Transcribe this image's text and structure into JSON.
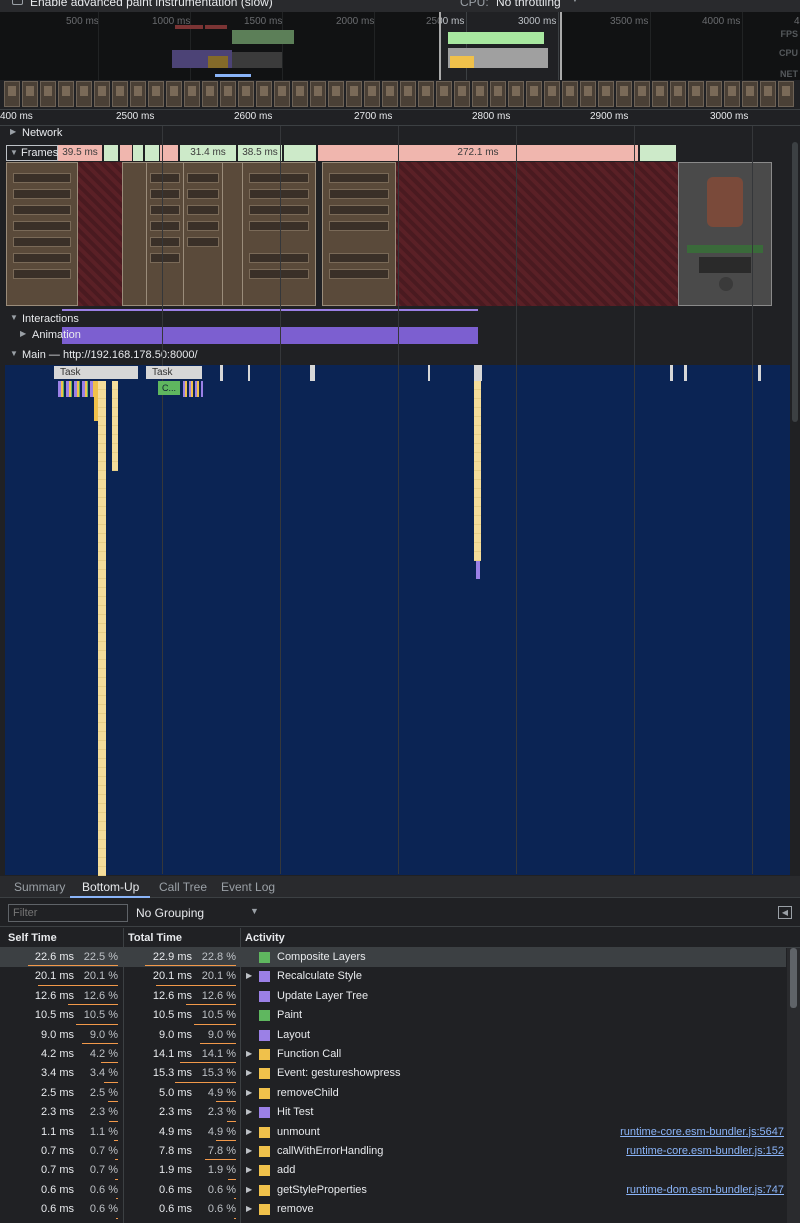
{
  "toolbar": {
    "paint_checkbox_label": "Enable advanced paint instrumentation (slow)",
    "cpu_label": "CPU:",
    "cpu_value": "No throttling"
  },
  "overview": {
    "ticks": [
      "500 ms",
      "1000 ms",
      "1500 ms",
      "2000 ms",
      "2500 ms",
      "3000 ms",
      "3500 ms",
      "4000 ms",
      "4"
    ],
    "lanes": [
      "FPS",
      "CPU",
      "NET"
    ]
  },
  "ruler": {
    "ticks": [
      "400 ms",
      "2500 ms",
      "2600 ms",
      "2700 ms",
      "2800 ms",
      "2900 ms",
      "3000 ms"
    ]
  },
  "tracks": {
    "network": "Network",
    "frames": "Frames",
    "interactions": "Interactions",
    "animation": "Animation",
    "main": "Main — http://192.168.178.50:8000/"
  },
  "frames": {
    "durations": [
      "39.5 ms",
      "31.4 ms",
      "38.5 ms",
      "272.1 ms"
    ]
  },
  "main_tasks": [
    "Task",
    "Task"
  ],
  "main_subtask": "C...",
  "panel": {
    "tabs": [
      "Summary",
      "Bottom-Up",
      "Call Tree",
      "Event Log"
    ],
    "active_tab": "Bottom-Up",
    "filter_placeholder": "Filter",
    "grouping": "No Grouping",
    "columns": {
      "self": "Self Time",
      "total": "Total Time",
      "activity": "Activity"
    }
  },
  "colors": {
    "rendering": "#9b80e6",
    "painting": "#5fb75f",
    "scripting": "#f0c14b",
    "timeline_bg": "#0b2454"
  },
  "rows": [
    {
      "self": "22.6 ms",
      "self_pct": "22.5 %",
      "total": "22.9 ms",
      "total_pct": "22.8 %",
      "activity": "Composite Layers",
      "color": "#5fb75f",
      "expandable": false,
      "source": "",
      "selected": true,
      "self_frac": 0.225
    },
    {
      "self": "20.1 ms",
      "self_pct": "20.1 %",
      "total": "20.1 ms",
      "total_pct": "20.1 %",
      "activity": "Recalculate Style",
      "color": "#9b80e6",
      "expandable": true,
      "source": "",
      "selected": false,
      "self_frac": 0.201
    },
    {
      "self": "12.6 ms",
      "self_pct": "12.6 %",
      "total": "12.6 ms",
      "total_pct": "12.6 %",
      "activity": "Update Layer Tree",
      "color": "#9b80e6",
      "expandable": false,
      "source": "",
      "selected": false,
      "self_frac": 0.126
    },
    {
      "self": "10.5 ms",
      "self_pct": "10.5 %",
      "total": "10.5 ms",
      "total_pct": "10.5 %",
      "activity": "Paint",
      "color": "#5fb75f",
      "expandable": false,
      "source": "",
      "selected": false,
      "self_frac": 0.105
    },
    {
      "self": "9.0 ms",
      "self_pct": "9.0 %",
      "total": "9.0 ms",
      "total_pct": "9.0 %",
      "activity": "Layout",
      "color": "#9b80e6",
      "expandable": false,
      "source": "",
      "selected": false,
      "self_frac": 0.09
    },
    {
      "self": "4.2 ms",
      "self_pct": "4.2 %",
      "total": "14.1 ms",
      "total_pct": "14.1 %",
      "activity": "Function Call",
      "color": "#f0c14b",
      "expandable": true,
      "source": "",
      "selected": false,
      "self_frac": 0.042
    },
    {
      "self": "3.4 ms",
      "self_pct": "3.4 %",
      "total": "15.3 ms",
      "total_pct": "15.3 %",
      "activity": "Event: gestureshowpress",
      "color": "#f0c14b",
      "expandable": true,
      "source": "",
      "selected": false,
      "self_frac": 0.034
    },
    {
      "self": "2.5 ms",
      "self_pct": "2.5 %",
      "total": "5.0 ms",
      "total_pct": "4.9 %",
      "activity": "removeChild",
      "color": "#f0c14b",
      "expandable": true,
      "source": "",
      "selected": false,
      "self_frac": 0.025
    },
    {
      "self": "2.3 ms",
      "self_pct": "2.3 %",
      "total": "2.3 ms",
      "total_pct": "2.3 %",
      "activity": "Hit Test",
      "color": "#9b80e6",
      "expandable": true,
      "source": "",
      "selected": false,
      "self_frac": 0.023
    },
    {
      "self": "1.1 ms",
      "self_pct": "1.1 %",
      "total": "4.9 ms",
      "total_pct": "4.9 %",
      "activity": "unmount",
      "color": "#f0c14b",
      "expandable": true,
      "source": "runtime-core.esm-bundler.js:5647",
      "selected": false,
      "self_frac": 0.011
    },
    {
      "self": "0.7 ms",
      "self_pct": "0.7 %",
      "total": "7.8 ms",
      "total_pct": "7.8 %",
      "activity": "callWithErrorHandling",
      "color": "#f0c14b",
      "expandable": true,
      "source": "runtime-core.esm-bundler.js:152",
      "selected": false,
      "self_frac": 0.007
    },
    {
      "self": "0.7 ms",
      "self_pct": "0.7 %",
      "total": "1.9 ms",
      "total_pct": "1.9 %",
      "activity": "add",
      "color": "#f0c14b",
      "expandable": true,
      "source": "",
      "selected": false,
      "self_frac": 0.007
    },
    {
      "self": "0.6 ms",
      "self_pct": "0.6 %",
      "total": "0.6 ms",
      "total_pct": "0.6 %",
      "activity": "getStyleProperties",
      "color": "#f0c14b",
      "expandable": true,
      "source": "runtime-dom.esm-bundler.js:747",
      "selected": false,
      "self_frac": 0.006
    },
    {
      "self": "0.6 ms",
      "self_pct": "0.6 %",
      "total": "0.6 ms",
      "total_pct": "0.6 %",
      "activity": "remove",
      "color": "#f0c14b",
      "expandable": true,
      "source": "",
      "selected": false,
      "self_frac": 0.006
    }
  ]
}
